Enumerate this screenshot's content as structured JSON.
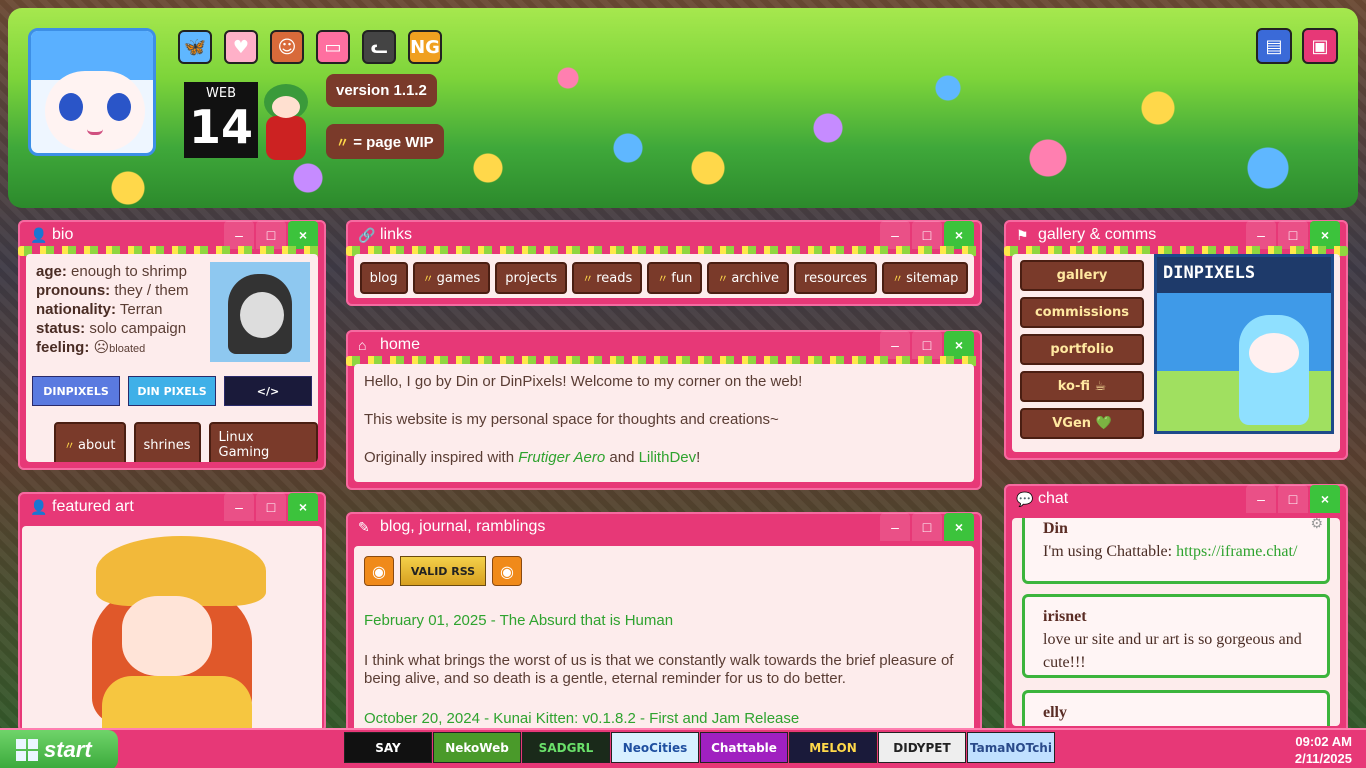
{
  "header": {
    "web14": {
      "top": "WEB",
      "num": "14"
    },
    "version": "version 1.1.2",
    "wip_label": "= page WIP",
    "icons": [
      {
        "name": "bluesky-icon",
        "glyph": "🦋",
        "color": "#5fb7ff"
      },
      {
        "name": "kofi-cup-icon",
        "glyph": "♥",
        "color": "#ffb0c8"
      },
      {
        "name": "character-icon",
        "glyph": "☺",
        "color": "#d86a3a"
      },
      {
        "name": "bread-icon",
        "glyph": "▭",
        "color": "#ff6fa0"
      },
      {
        "name": "cat-icon",
        "glyph": "ᓚ",
        "color": "#444444"
      },
      {
        "name": "newgrounds-icon",
        "glyph": "NG",
        "color": "#f0a020"
      }
    ],
    "right_icons": [
      {
        "name": "pixel-scene-icon",
        "glyph": "▤",
        "color": "#3a6ad8"
      },
      {
        "name": "pixel-window-icon",
        "glyph": "▣",
        "color": "#e73877"
      }
    ]
  },
  "windows": {
    "min": "–",
    "max": "□",
    "close": "×"
  },
  "bio": {
    "title": "bio",
    "rows": [
      {
        "k": "age:",
        "v": "enough to shrimp"
      },
      {
        "k": "pronouns:",
        "v": "they / them"
      },
      {
        "k": "nationality:",
        "v": "Terran"
      },
      {
        "k": "status:",
        "v": "solo campaign"
      },
      {
        "k": "feeling:",
        "v": "bloated"
      }
    ],
    "banners": [
      "DINPIXELS",
      "DIN PIXELS",
      "</>"
    ],
    "buttons": [
      "about",
      "shrines",
      "Linux Gaming"
    ]
  },
  "featured": {
    "title": "featured art"
  },
  "links": {
    "title": "links",
    "items": [
      {
        "label": "blog",
        "wip": false
      },
      {
        "label": "games",
        "wip": true
      },
      {
        "label": "projects",
        "wip": false
      },
      {
        "label": "reads",
        "wip": true
      },
      {
        "label": "fun",
        "wip": true
      },
      {
        "label": "archive",
        "wip": true
      },
      {
        "label": "resources",
        "wip": false
      },
      {
        "label": "sitemap",
        "wip": true
      }
    ]
  },
  "home": {
    "title": "home",
    "p1": "Hello, I go by Din or DinPixels! Welcome to my corner on the web!",
    "p2": "This website is my personal space for thoughts and creations~",
    "p3_prefix": "Originally inspired with ",
    "link1": "Frutiger Aero",
    "and": " and ",
    "link2": "LilithDev",
    "excl": "!"
  },
  "blog": {
    "title": "blog, journal, ramblings",
    "valid_rss": "VALID RSS",
    "post1": "February 01, 2025 - The Absurd that is Human",
    "post1_text": "I think what brings the worst of us is that we constantly walk towards the brief pleasure of being alive, and so death is a gentle, eternal reminder for us to do better.",
    "post2": "October 20, 2024 - Kunai Kitten: v0.1.8.2 - First and Jam Release"
  },
  "gallery": {
    "title": "gallery & comms",
    "buttons": [
      "gallery",
      "commissions",
      "portfolio",
      "ko-fi ☕",
      "VGen 💚"
    ],
    "pic_label": "DINPIXELS"
  },
  "chat": {
    "title": "chat",
    "messages": [
      {
        "who": "Din",
        "text": "I'm using Chattable: ",
        "link": "https://iframe.chat/"
      },
      {
        "who": "irisnet",
        "text": "love ur site and ur art is so gorgeous and cute!!!"
      },
      {
        "who": "elly",
        "text": ""
      }
    ]
  },
  "taskbar": {
    "start": "start",
    "banners": [
      {
        "label": "SAY",
        "bg": "#111111",
        "fg": "#ffffff"
      },
      {
        "label": "NekoWeb",
        "bg": "#4a9a2a",
        "fg": "#ffffff"
      },
      {
        "label": "SADGRL",
        "bg": "#1a2a1a",
        "fg": "#6ae06a"
      },
      {
        "label": "NeoCities",
        "bg": "#d8f0ff",
        "fg": "#2050a0"
      },
      {
        "label": "Chattable",
        "bg": "#a020c0",
        "fg": "#ffffff"
      },
      {
        "label": "MELON",
        "bg": "#1a1a3a",
        "fg": "#ffd84a"
      },
      {
        "label": "DIDYPET",
        "bg": "#eeeeee",
        "fg": "#222222"
      },
      {
        "label": "TamaNOTchi",
        "bg": "#c0e0ff",
        "fg": "#2a4a8a"
      }
    ],
    "time": "09:02 AM",
    "date": "2/11/2025"
  }
}
